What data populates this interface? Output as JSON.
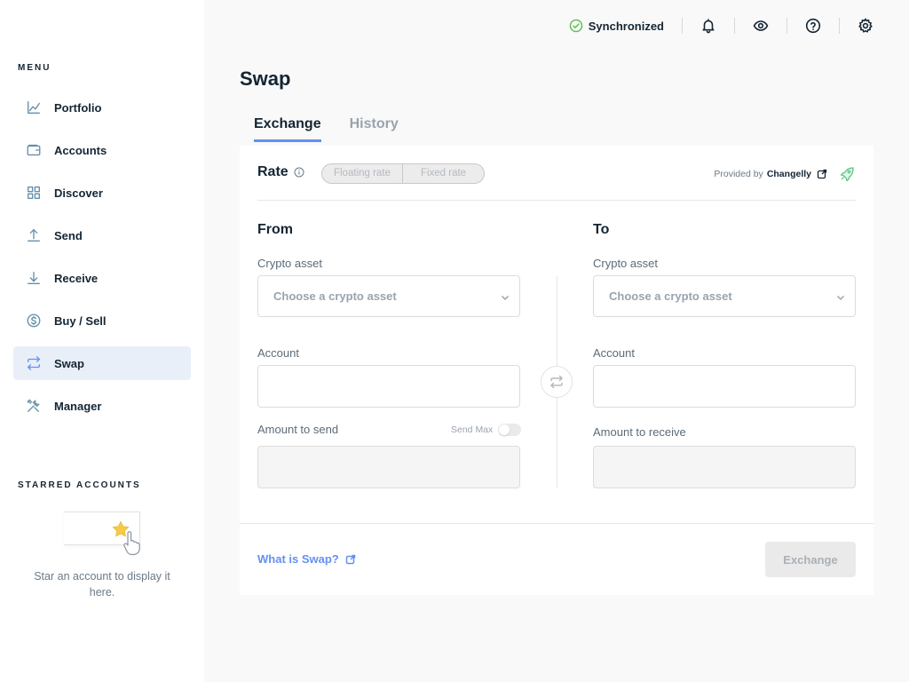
{
  "sidebar": {
    "menu_title": "MENU",
    "items": [
      {
        "label": "Portfolio",
        "icon": "chart-icon"
      },
      {
        "label": "Accounts",
        "icon": "wallet-icon"
      },
      {
        "label": "Discover",
        "icon": "grid-icon"
      },
      {
        "label": "Send",
        "icon": "arrow-up-icon"
      },
      {
        "label": "Receive",
        "icon": "arrow-down-icon"
      },
      {
        "label": "Buy / Sell",
        "icon": "dollar-icon"
      },
      {
        "label": "Swap",
        "icon": "swap-icon",
        "active": true
      },
      {
        "label": "Manager",
        "icon": "tools-icon"
      }
    ],
    "starred_title": "STARRED ACCOUNTS",
    "starred_empty_text": "Star an account to display it here."
  },
  "topbar": {
    "sync_status": "Synchronized",
    "icons": [
      "bell-icon",
      "eye-icon",
      "help-icon",
      "settings-icon"
    ]
  },
  "main": {
    "title": "Swap",
    "tabs": [
      {
        "label": "Exchange",
        "active": true
      },
      {
        "label": "History",
        "active": false
      }
    ],
    "rate": {
      "label": "Rate",
      "options": [
        "Floating rate",
        "Fixed rate"
      ],
      "provided_by_label": "Provided by",
      "provider": "Changelly"
    },
    "from": {
      "title": "From",
      "crypto_label": "Crypto asset",
      "crypto_placeholder": "Choose a crypto asset",
      "account_label": "Account",
      "amount_label": "Amount to send",
      "send_max_label": "Send Max"
    },
    "to": {
      "title": "To",
      "crypto_label": "Crypto asset",
      "crypto_placeholder": "Choose a crypto asset",
      "account_label": "Account",
      "amount_label": "Amount to receive"
    },
    "footer": {
      "what_is_link": "What is Swap?",
      "exchange_button": "Exchange"
    }
  },
  "colors": {
    "accent": "#6490f1",
    "success": "#66be54",
    "active_nav_bg": "#e9eff9"
  }
}
